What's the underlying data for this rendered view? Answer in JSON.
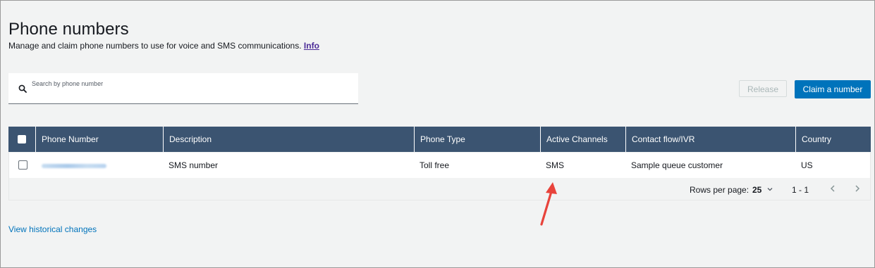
{
  "page": {
    "title": "Phone numbers",
    "description": "Manage and claim phone numbers to use for voice and SMS communications.",
    "info_link": "Info"
  },
  "search": {
    "placeholder": "Search by phone number"
  },
  "actions": {
    "release_label": "Release",
    "claim_label": "Claim a number"
  },
  "table": {
    "columns": [
      "Phone Number",
      "Description",
      "Phone Type",
      "Active Channels",
      "Contact flow/IVR",
      "Country"
    ],
    "rows": [
      {
        "description": "SMS number",
        "phone_type": "Toll free",
        "active_channels": "SMS",
        "contact_flow": "Sample queue customer",
        "country": "US"
      }
    ]
  },
  "pagination": {
    "rows_per_page_label": "Rows per page:",
    "rows_per_page_value": "25",
    "range": "1 - 1"
  },
  "footer": {
    "history_link": "View historical changes"
  },
  "colors": {
    "header_bg": "#3b5471",
    "primary": "#0073bb",
    "link_visited": "#4b2a97",
    "annotation_arrow": "#e8433b"
  }
}
